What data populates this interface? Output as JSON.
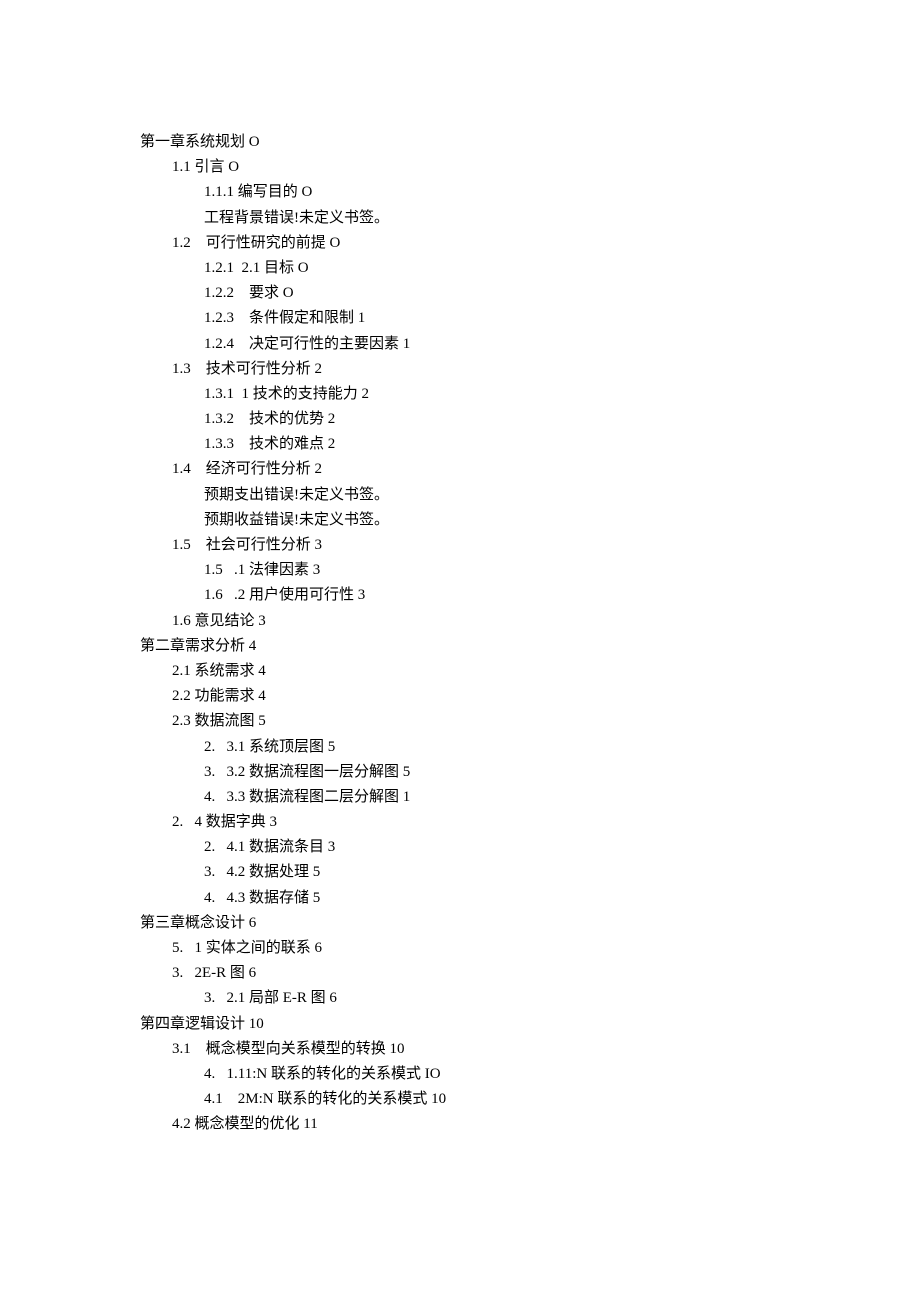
{
  "toc": [
    {
      "level": 0,
      "text": "第一章系统规划 O"
    },
    {
      "level": 1,
      "text": "1.1 引言 O"
    },
    {
      "level": 2,
      "text": "1.1.1 编写目的 O"
    },
    {
      "level": 2,
      "text": "工程背景错误!未定义书签。"
    },
    {
      "level": 1,
      "text": "1.2    可行性研究的前提 O"
    },
    {
      "level": 2,
      "text": "1.2.1  2.1 目标 O"
    },
    {
      "level": 2,
      "text": "1.2.2    要求 O"
    },
    {
      "level": 2,
      "text": "1.2.3    条件假定和限制 1"
    },
    {
      "level": 2,
      "text": "1.2.4    决定可行性的主要因素 1"
    },
    {
      "level": 1,
      "text": "1.3    技术可行性分析 2"
    },
    {
      "level": 2,
      "text": "1.3.1  1 技术的支持能力 2"
    },
    {
      "level": 2,
      "text": "1.3.2    技术的优势 2"
    },
    {
      "level": 2,
      "text": "1.3.3    技术的难点 2"
    },
    {
      "level": 1,
      "text": "1.4    经济可行性分析 2"
    },
    {
      "level": 2,
      "text": "预期支出错误!未定义书签。"
    },
    {
      "level": 2,
      "text": "预期收益错误!未定义书签。"
    },
    {
      "level": 1,
      "text": "1.5    社会可行性分析 3"
    },
    {
      "level": 2,
      "text": "1.5   .1 法律因素 3"
    },
    {
      "level": 2,
      "text": "1.6   .2 用户使用可行性 3"
    },
    {
      "level": 1,
      "text": "1.6 意见结论 3"
    },
    {
      "level": 0,
      "text": "第二章需求分析 4"
    },
    {
      "level": 1,
      "text": "2.1 系统需求 4"
    },
    {
      "level": 1,
      "text": "2.2 功能需求 4"
    },
    {
      "level": 1,
      "text": "2.3 数据流图 5"
    },
    {
      "level": 2,
      "text": "2.   3.1 系统顶层图 5"
    },
    {
      "level": 2,
      "text": "3.   3.2 数据流程图一层分解图 5"
    },
    {
      "level": 2,
      "text": "4.   3.3 数据流程图二层分解图 1"
    },
    {
      "level": 1,
      "text": "2.   4 数据字典 3"
    },
    {
      "level": 2,
      "text": "2.   4.1 数据流条目 3"
    },
    {
      "level": 2,
      "text": "3.   4.2 数据处理 5"
    },
    {
      "level": 2,
      "text": "4.   4.3 数据存储 5"
    },
    {
      "level": 0,
      "text": "第三章概念设计 6"
    },
    {
      "level": 1,
      "text": "5.   1 实体之间的联系 6"
    },
    {
      "level": 1,
      "text": "3.   2E-R 图 6"
    },
    {
      "level": 2,
      "text": "3.   2.1 局部 E-R 图 6"
    },
    {
      "level": 0,
      "text": "第四章逻辑设计 10"
    },
    {
      "level": 1,
      "text": "3.1    概念模型向关系模型的转换 10"
    },
    {
      "level": 2,
      "text": "4.   1.11:N 联系的转化的关系模式 IO"
    },
    {
      "level": 2,
      "text": "4.1    2M:N 联系的转化的关系模式 10"
    },
    {
      "level": 1,
      "text": "4.2 概念模型的优化 11"
    }
  ]
}
